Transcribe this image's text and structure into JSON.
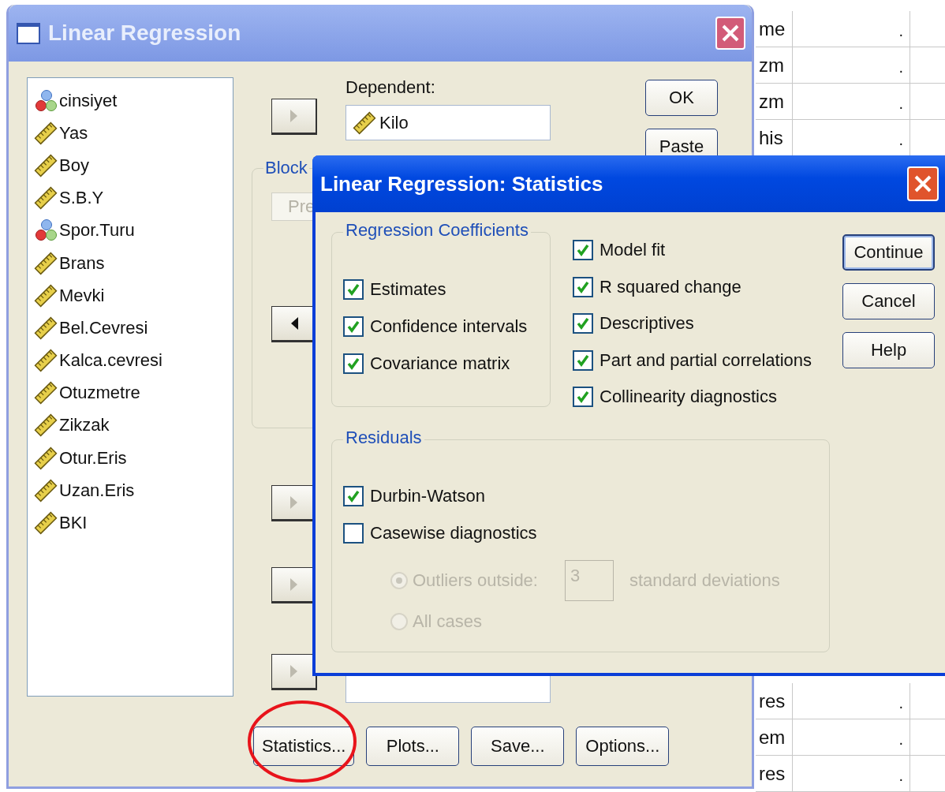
{
  "spreadsheet": {
    "rows_top": [
      {
        "column_1": "me",
        "column_2": "."
      },
      {
        "column_1": "zm",
        "column_2": "."
      },
      {
        "column_1": "zm",
        "column_2": "."
      },
      {
        "column_1": "his",
        "column_2": "."
      }
    ],
    "rows_bottom": [
      {
        "column_1": "res",
        "column_2": "."
      },
      {
        "column_1": "em",
        "column_2": "."
      },
      {
        "column_1": "res",
        "column_2": "."
      }
    ]
  },
  "main_dialog": {
    "title": "Linear Regression",
    "variables": [
      {
        "name": "cinsiyet",
        "kind": "nominal"
      },
      {
        "name": "Yas",
        "kind": "scale"
      },
      {
        "name": "Boy",
        "kind": "scale"
      },
      {
        "name": "S.B.Y",
        "kind": "scale"
      },
      {
        "name": "Spor.Turu",
        "kind": "nominal"
      },
      {
        "name": "Brans",
        "kind": "scale"
      },
      {
        "name": "Mevki",
        "kind": "scale"
      },
      {
        "name": "Bel.Cevresi",
        "kind": "scale"
      },
      {
        "name": "Kalca.cevresi",
        "kind": "scale"
      },
      {
        "name": "Otuzmetre",
        "kind": "scale"
      },
      {
        "name": "Zikzak",
        "kind": "scale"
      },
      {
        "name": "Otur.Eris",
        "kind": "scale"
      },
      {
        "name": "Uzan.Eris",
        "kind": "scale"
      },
      {
        "name": "BKI",
        "kind": "scale"
      }
    ],
    "dependent": {
      "label": "Dependent:",
      "value": "Kilo",
      "kind": "scale",
      "arrow": {
        "kind": "right",
        "disabled": true
      }
    },
    "block": {
      "label": "Block",
      "previous_button": "Pre",
      "arrow": {
        "kind": "left",
        "disabled": false
      }
    },
    "lower_arrows": [
      {
        "kind": "right",
        "disabled": true
      },
      {
        "kind": "right",
        "disabled": true
      },
      {
        "kind": "right",
        "disabled": true
      }
    ],
    "side_buttons": [
      "OK",
      "Paste"
    ],
    "bottom_buttons": [
      {
        "label": "Statistics...",
        "highlighted": true
      },
      {
        "label": "Plots...",
        "highlighted": false
      },
      {
        "label": "Save...",
        "highlighted": false
      },
      {
        "label": "Options...",
        "highlighted": false
      }
    ]
  },
  "statistics_dialog": {
    "title": "Linear Regression: Statistics",
    "coefficients": {
      "label": "Regression Coefficients",
      "items": [
        {
          "label": "Estimates",
          "checked": true
        },
        {
          "label": "Confidence intervals",
          "checked": true
        },
        {
          "label": "Covariance matrix",
          "checked": true
        }
      ]
    },
    "options": [
      {
        "label": "Model fit",
        "checked": true
      },
      {
        "label": "R squared change",
        "checked": true
      },
      {
        "label": "Descriptives",
        "checked": true
      },
      {
        "label": "Part and partial correlations",
        "checked": true
      },
      {
        "label": "Collinearity diagnostics",
        "checked": true
      }
    ],
    "residuals": {
      "label": "Residuals",
      "items": [
        {
          "label": "Durbin-Watson",
          "checked": true
        },
        {
          "label": "Casewise diagnostics",
          "checked": false
        }
      ],
      "choices": [
        {
          "label": "Outliers outside:",
          "selected": true,
          "disabled": true
        },
        {
          "label": "All cases",
          "selected": false,
          "disabled": true
        }
      ],
      "outlier_value": "3",
      "outlier_unit": "standard deviations"
    },
    "buttons": [
      "Continue",
      "Cancel",
      "Help"
    ]
  }
}
